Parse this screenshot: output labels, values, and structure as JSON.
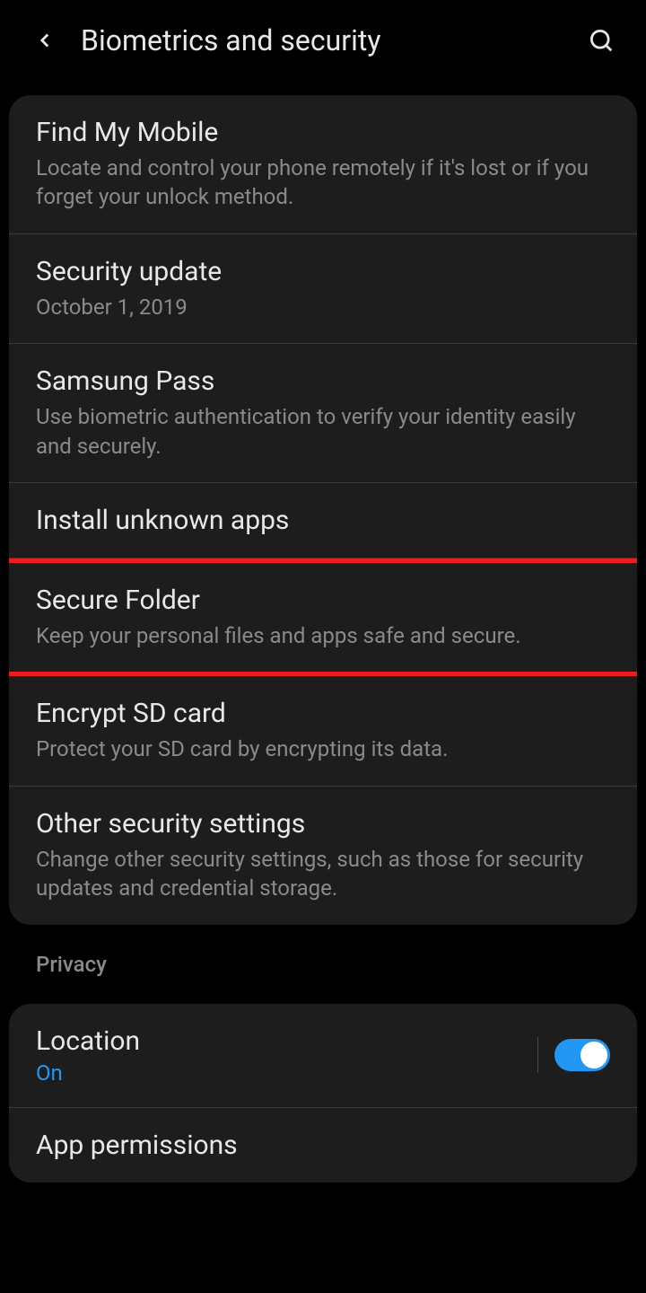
{
  "header": {
    "title": "Biometrics and security"
  },
  "section1": {
    "items": [
      {
        "title": "Find My Mobile",
        "desc": "Locate and control your phone remotely if it's lost or if you forget your unlock method."
      },
      {
        "title": "Security update",
        "desc": "October 1, 2019"
      },
      {
        "title": "Samsung Pass",
        "desc": "Use biometric authentication to verify your identity easily and securely."
      },
      {
        "title": "Install unknown apps",
        "desc": ""
      },
      {
        "title": "Secure Folder",
        "desc": "Keep your personal files and apps safe and secure."
      },
      {
        "title": "Encrypt SD card",
        "desc": "Protect your SD card by encrypting its data."
      },
      {
        "title": "Other security settings",
        "desc": "Change other security settings, such as those for security updates and credential storage."
      }
    ]
  },
  "privacy": {
    "label": "Privacy",
    "location": {
      "title": "Location",
      "status": "On"
    },
    "app_permissions": {
      "title": "App permissions"
    }
  }
}
